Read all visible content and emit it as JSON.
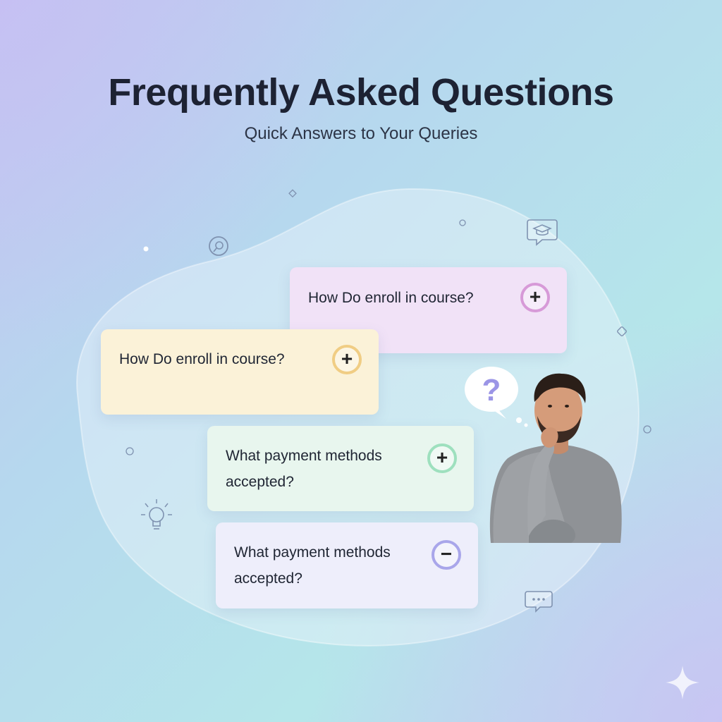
{
  "header": {
    "title": "Frequently Asked Questions",
    "subtitle": "Quick Answers to Your Queries"
  },
  "faq": {
    "items": [
      {
        "question": "How Do enroll in course?",
        "toggle": "+",
        "state": "collapsed",
        "accent": "#d79ad8",
        "background": "#f1e2f7"
      },
      {
        "question": "How Do enroll in course?",
        "toggle": "+",
        "state": "collapsed",
        "accent": "#f0cd84",
        "background": "#fbf2d8"
      },
      {
        "question": "What payment methods accepted?",
        "toggle": "+",
        "state": "collapsed",
        "accent": "#9ee0be",
        "background": "#e8f6ee"
      },
      {
        "question": "What payment methods accepted?",
        "toggle": "−",
        "state": "expanded",
        "accent": "#a9a6ea",
        "background": "#eeeefb"
      }
    ]
  },
  "illustration": {
    "thought_bubble": "?",
    "icons": [
      "graduation-cap-chat-icon",
      "lightbulb-icon",
      "chat-dots-icon",
      "search-icon",
      "sparkle-icon"
    ]
  }
}
